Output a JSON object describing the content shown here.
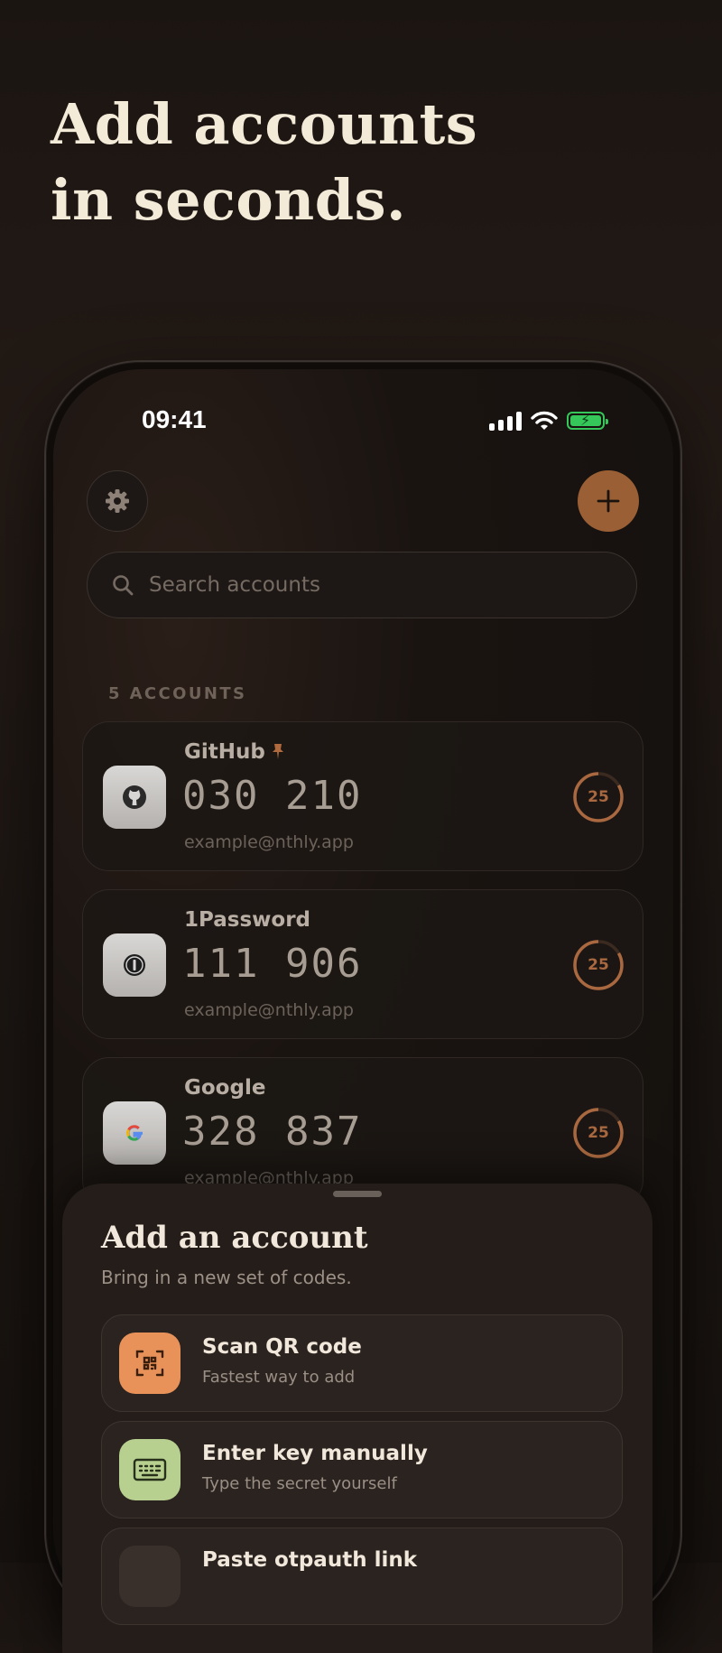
{
  "headline": {
    "line1": "Add accounts",
    "line2": "in seconds."
  },
  "status_bar": {
    "time": "09:41"
  },
  "search": {
    "placeholder": "Search accounts"
  },
  "accounts_count_label": "5 ACCOUNTS",
  "accounts": [
    {
      "name": "GitHub",
      "pinned": true,
      "code": "030 210",
      "email": "example@nthly.app",
      "timer": "25",
      "icon": "github-icon"
    },
    {
      "name": "1Password",
      "pinned": false,
      "code": "111 906",
      "email": "example@nthly.app",
      "timer": "25",
      "icon": "onepassword-icon"
    },
    {
      "name": "Google",
      "pinned": false,
      "code": "328 837",
      "email": "example@nthly.app",
      "timer": "25",
      "icon": "google-icon"
    }
  ],
  "sheet": {
    "title": "Add an account",
    "subtitle": "Bring in a new set of codes.",
    "options": [
      {
        "title": "Scan QR code",
        "subtitle": "Fastest way to add",
        "icon": "qr-scan-icon",
        "color": "#e8925a"
      },
      {
        "title": "Enter key manually",
        "subtitle": "Type the secret yourself",
        "icon": "keyboard-icon",
        "color": "#b8d08f"
      },
      {
        "title": "Paste otpauth link",
        "subtitle": "",
        "icon": "link-icon",
        "color": "#3a302b"
      }
    ]
  },
  "colors": {
    "accent": "#9a5f34",
    "timer": "#a9683f",
    "pin": "#b06a3e"
  }
}
